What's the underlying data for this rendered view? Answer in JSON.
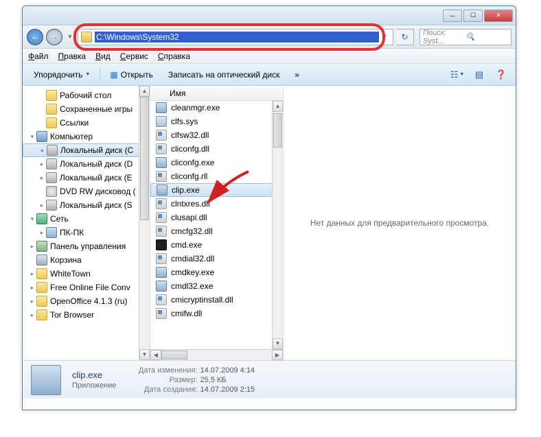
{
  "address_bar": {
    "path": "C:\\Windows\\System32"
  },
  "search": {
    "placeholder": "Поиск: Syst..."
  },
  "menu": {
    "file": "Файл",
    "edit": "Правка",
    "view": "Вид",
    "tools": "Сервис",
    "help": "Справка"
  },
  "toolbar": {
    "organize": "Упорядочить",
    "open": "Открыть",
    "burn": "Записать на оптический диск",
    "more": "»"
  },
  "column_header": "Имя",
  "sidebar": {
    "items": [
      {
        "label": "Рабочий стол",
        "icon": "ic-folder",
        "level": 1,
        "exp": ""
      },
      {
        "label": "Сохраненные игры",
        "icon": "ic-folder",
        "level": 1,
        "exp": ""
      },
      {
        "label": "Ссылки",
        "icon": "ic-folder",
        "level": 1,
        "exp": ""
      },
      {
        "label": "Компьютер",
        "icon": "ic-computer",
        "level": 0,
        "exp": "▾"
      },
      {
        "label": "Локальный диск (C",
        "icon": "ic-disk",
        "level": 1,
        "exp": "▸",
        "selected": true
      },
      {
        "label": "Локальный диск (D",
        "icon": "ic-disk",
        "level": 1,
        "exp": "▸"
      },
      {
        "label": "Локальный диск (E",
        "icon": "ic-disk",
        "level": 1,
        "exp": "▸"
      },
      {
        "label": "DVD RW дисковод (",
        "icon": "ic-dvd",
        "level": 1,
        "exp": ""
      },
      {
        "label": "Локальный диск (S",
        "icon": "ic-disk",
        "level": 1,
        "exp": "▸"
      },
      {
        "label": "Сеть",
        "icon": "ic-net",
        "level": 0,
        "exp": "▾"
      },
      {
        "label": "ПК-ПК",
        "icon": "ic-pc",
        "level": 1,
        "exp": "▸"
      },
      {
        "label": "Панель управления",
        "icon": "ic-panel",
        "level": 0,
        "exp": "▸"
      },
      {
        "label": "Корзина",
        "icon": "ic-bin",
        "level": 0,
        "exp": ""
      },
      {
        "label": "WhiteTown",
        "icon": "ic-folder",
        "level": 0,
        "exp": "▸"
      },
      {
        "label": "Free Online File Conv",
        "icon": "ic-folder",
        "level": 0,
        "exp": "▸"
      },
      {
        "label": "OpenOffice 4.1.3 (ru)",
        "icon": "ic-folder",
        "level": 0,
        "exp": "▸"
      },
      {
        "label": "Tor Browser",
        "icon": "ic-folder",
        "level": 0,
        "exp": "▸"
      }
    ]
  },
  "files": [
    {
      "name": "cleanmgr.exe",
      "icon": "ic-exe"
    },
    {
      "name": "clfs.sys",
      "icon": "ic-sys"
    },
    {
      "name": "clfsw32.dll",
      "icon": "ic-dll"
    },
    {
      "name": "cliconfg.dll",
      "icon": "ic-dll"
    },
    {
      "name": "cliconfg.exe",
      "icon": "ic-exe"
    },
    {
      "name": "cliconfg.rll",
      "icon": "ic-dll"
    },
    {
      "name": "clip.exe",
      "icon": "ic-exe",
      "selected": true
    },
    {
      "name": "clntxres.dll",
      "icon": "ic-dll"
    },
    {
      "name": "clusapi.dll",
      "icon": "ic-dll"
    },
    {
      "name": "cmcfg32.dll",
      "icon": "ic-dll"
    },
    {
      "name": "cmd.exe",
      "icon": "ic-cmd"
    },
    {
      "name": "cmdial32.dll",
      "icon": "ic-dll"
    },
    {
      "name": "cmdkey.exe",
      "icon": "ic-exe"
    },
    {
      "name": "cmdl32.exe",
      "icon": "ic-exe"
    },
    {
      "name": "cmicryptinstall.dll",
      "icon": "ic-dll"
    },
    {
      "name": "cmifw.dll",
      "icon": "ic-dll"
    }
  ],
  "preview": {
    "empty": "Нет данных для предварительного просмотра."
  },
  "details": {
    "name": "clip.exe",
    "type": "Приложение",
    "modified_label": "Дата изменения:",
    "modified": "14.07.2009 4:14",
    "size_label": "Размер:",
    "size": "25,5 КБ",
    "created_label": "Дата создания:",
    "created": "14.07.2009 2:15"
  }
}
